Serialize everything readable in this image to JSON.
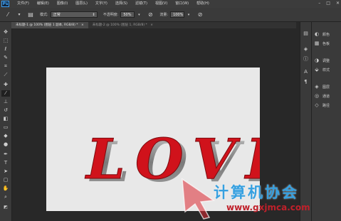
{
  "app": {
    "logo": "Ps"
  },
  "menu": [
    "文件(F)",
    "编辑(E)",
    "图像(I)",
    "图层(L)",
    "文字(Y)",
    "选择(S)",
    "滤镜(T)",
    "视图(V)",
    "窗口(W)",
    "帮助(H)"
  ],
  "window_controls": {
    "minimize": "–",
    "restore": "□",
    "close": "✕"
  },
  "options_bar": {
    "mode_label": "模式:",
    "mode_value": "正常",
    "opacity_label": "不透明度:",
    "opacity_value": "50%",
    "flow_label": "流量:",
    "flow_value": "100%"
  },
  "tabs": [
    {
      "label": "未标题-1 @ 100% (图层 1 副本, RGB/8) *",
      "close": "×"
    },
    {
      "label": "未标题-2 @ 100% (图层 1, RGB/8) *",
      "close": "×"
    }
  ],
  "canvas": {
    "text": "LOVE",
    "background": "#e8e8e8",
    "text_color": "#d0121b",
    "bevel_color": "#8a8a8a"
  },
  "panels": [
    {
      "icon": "color-icon",
      "label": "颜色"
    },
    {
      "icon": "swatches-icon",
      "label": "色板"
    },
    {
      "icon": "adjustments-icon",
      "label": "调整"
    },
    {
      "icon": "styles-icon",
      "label": "样式"
    },
    {
      "icon": "layers-icon",
      "label": "图层"
    },
    {
      "icon": "channels-icon",
      "label": "通道"
    },
    {
      "icon": "paths-icon",
      "label": "路径"
    }
  ],
  "watermark": {
    "text": "计算机协会",
    "url": "www.gxjmca.com",
    "color_text": "#36a0e0",
    "color_url": "#c0202a"
  }
}
